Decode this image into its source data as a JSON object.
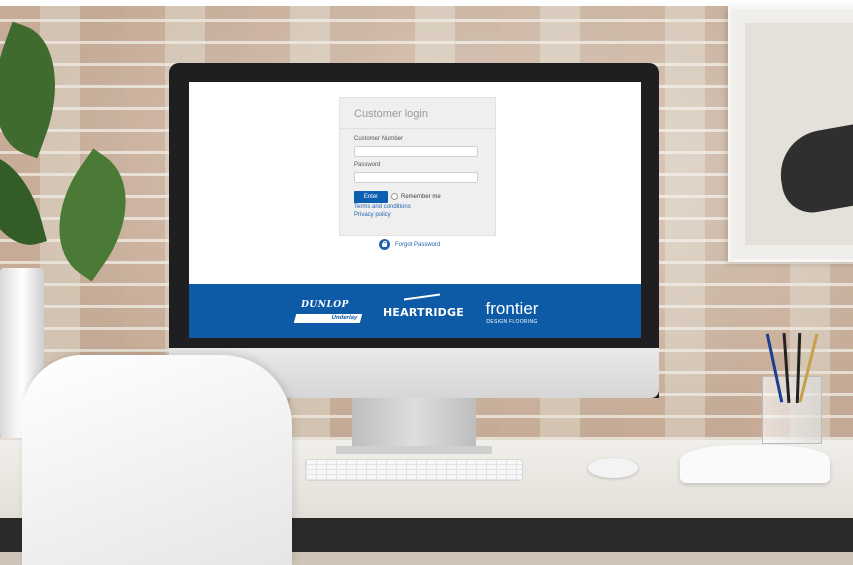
{
  "login": {
    "title": "Customer login",
    "customer_number_label": "Customer Number",
    "customer_number_value": "",
    "password_label": "Password",
    "password_value": "",
    "enter_label": "Enter",
    "remember_label": "Remember me",
    "terms_link": "Terms and conditions",
    "privacy_link": "Privacy policy",
    "forgot_label": "Forgot Password"
  },
  "brands": {
    "dunlop": "DUNLOP",
    "dunlop_sub": "Underlay",
    "heartridge": "HEARTRIDGE",
    "frontier": "frontier",
    "frontier_sub": "DESIGN FLOORING"
  },
  "colors": {
    "accent": "#0c5fb0",
    "footer_band": "#0d5aa7",
    "link": "#1e63ad"
  },
  "icons": {
    "forgot": "lock-icon"
  }
}
